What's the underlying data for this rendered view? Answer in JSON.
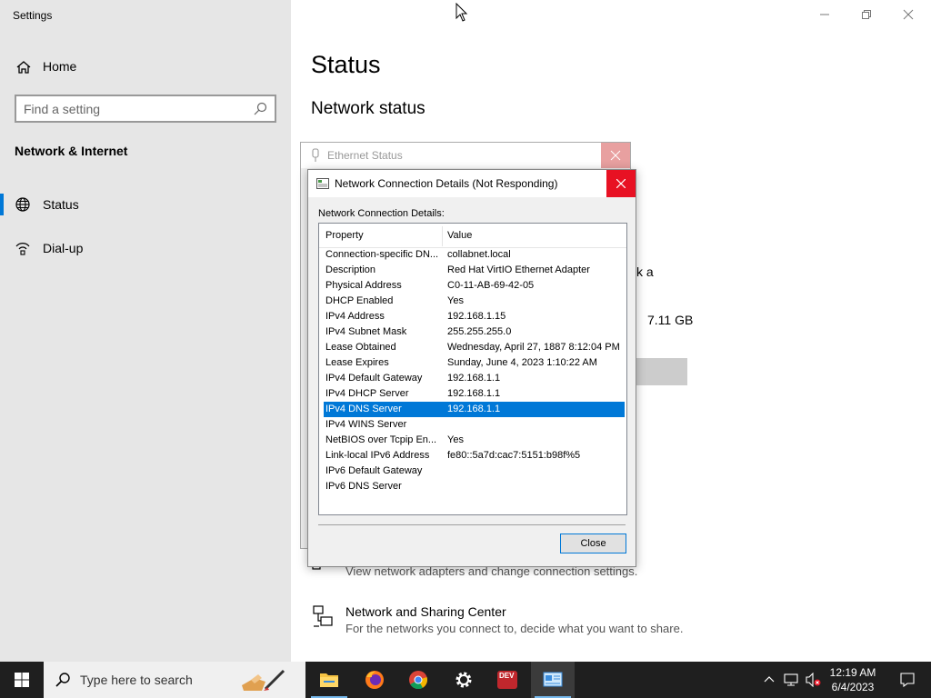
{
  "window": {
    "app_title": "Settings",
    "page_title": "Status",
    "section_heading": "Network status"
  },
  "sidebar": {
    "home_label": "Home",
    "search_placeholder": "Find a setting",
    "section_title": "Network & Internet",
    "items": [
      {
        "label": "Status",
        "icon": "globe-icon",
        "active": true
      },
      {
        "label": "Dial-up",
        "icon": "dialup-icon",
        "active": false
      }
    ]
  },
  "background_text": {
    "partial_a": "k a",
    "data_usage": "7.11 GB"
  },
  "links": [
    {
      "title": "",
      "description": "View network adapters and change connection settings.",
      "icon": "adapter-icon"
    },
    {
      "title": "Network and Sharing Center",
      "description": "For the networks you connect to, decide what you want to share.",
      "icon": "sharing-center-icon"
    }
  ],
  "ethernet_status": {
    "title": "Ethernet Status"
  },
  "details_dialog": {
    "title": "Network Connection Details (Not Responding)",
    "label": "Network Connection Details:",
    "columns": {
      "property": "Property",
      "value": "Value"
    },
    "rows": [
      {
        "property": "Connection-specific DN...",
        "value": "collabnet.local"
      },
      {
        "property": "Description",
        "value": "Red Hat VirtIO Ethernet Adapter"
      },
      {
        "property": "Physical Address",
        "value": "C0-11-AB-69-42-05"
      },
      {
        "property": "DHCP Enabled",
        "value": "Yes"
      },
      {
        "property": "IPv4 Address",
        "value": "192.168.1.15"
      },
      {
        "property": "IPv4 Subnet Mask",
        "value": "255.255.255.0"
      },
      {
        "property": "Lease Obtained",
        "value": "Wednesday, April 27, 1887 8:12:04 PM"
      },
      {
        "property": "Lease Expires",
        "value": "Sunday, June 4, 2023 1:10:22 AM"
      },
      {
        "property": "IPv4 Default Gateway",
        "value": "192.168.1.1"
      },
      {
        "property": "IPv4 DHCP Server",
        "value": "192.168.1.1"
      },
      {
        "property": "IPv4 DNS Server",
        "value": "192.168.1.1",
        "selected": true
      },
      {
        "property": "IPv4 WINS Server",
        "value": ""
      },
      {
        "property": "NetBIOS over Tcpip En...",
        "value": "Yes"
      },
      {
        "property": "Link-local IPv6 Address",
        "value": "fe80::5a7d:cac7:5151:b98f%5"
      },
      {
        "property": "IPv6 Default Gateway",
        "value": ""
      },
      {
        "property": "IPv6 DNS Server",
        "value": ""
      }
    ],
    "close_label": "Close"
  },
  "taskbar": {
    "search_placeholder": "Type here to search",
    "apps": [
      "file-explorer-icon",
      "firefox-icon",
      "chrome-icon",
      "settings-icon",
      "dev-cpp-icon",
      "network-details-icon"
    ],
    "dev_label": "DEV",
    "time": "12:19 AM",
    "date": "6/4/2023"
  },
  "colors": {
    "accent": "#0078d7",
    "close_red": "#e81123",
    "sidebar_bg": "#e6e6e6",
    "taskbar_bg": "#1f1f1f"
  }
}
